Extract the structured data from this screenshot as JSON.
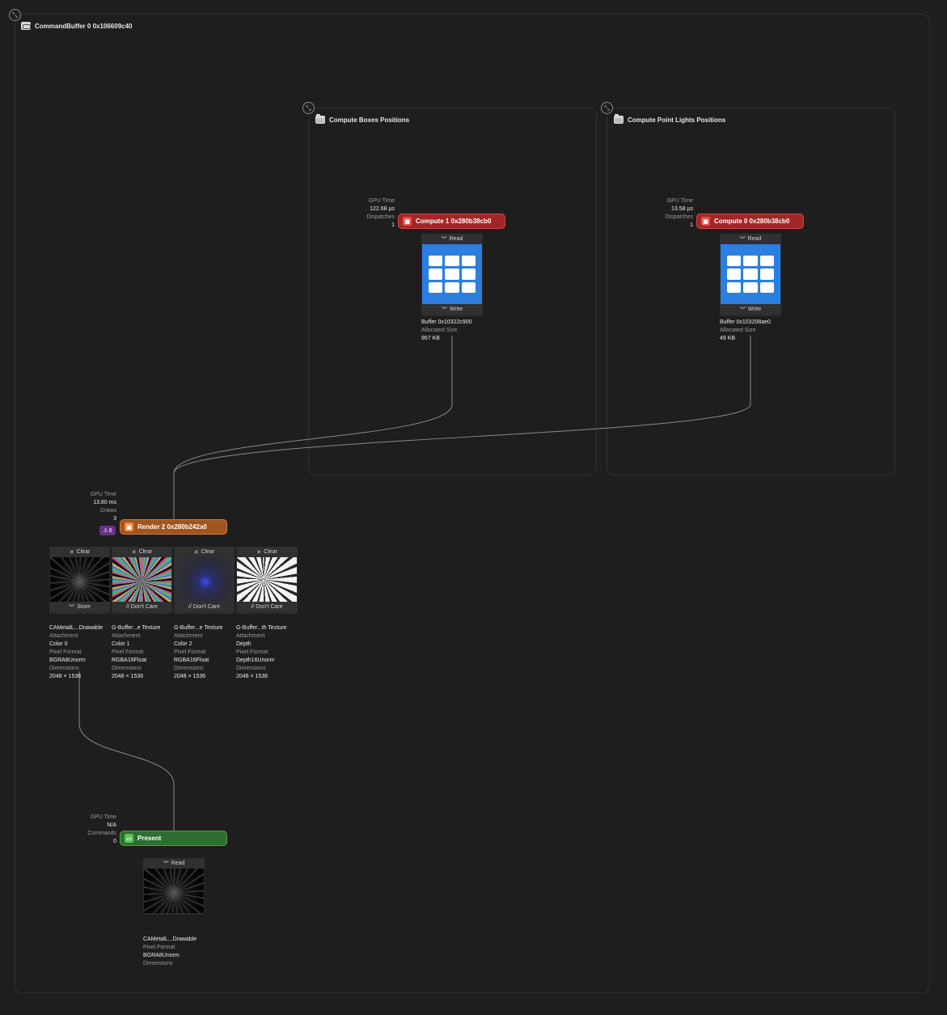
{
  "command_buffer": {
    "title": "CommandBuffer 0 0x106609c40"
  },
  "groups": [
    {
      "title": "Compute Boxes Positions"
    },
    {
      "title": "Compute Point Lights Positions"
    }
  ],
  "compute1": {
    "gpu_time_label": "GPU Time",
    "gpu_time": "122.68 µs",
    "dispatches_label": "Dispatches",
    "dispatches": "1",
    "label": "Compute 1 0x280b38cb0",
    "buffer": {
      "read": "Read",
      "write": "Write",
      "name": "Buffer 0x10322c900",
      "size_label": "Allocated Size",
      "size": "967 KB"
    }
  },
  "compute0": {
    "gpu_time_label": "GPU Time",
    "gpu_time": "13.58 µs",
    "dispatches_label": "Dispatches",
    "dispatches": "1",
    "label": "Compute 0 0x280b38cb0",
    "buffer": {
      "read": "Read",
      "write": "Write",
      "name": "Buffer 0x103208ae0",
      "size_label": "Allocated Size",
      "size": "49 KB"
    }
  },
  "render2": {
    "gpu_time_label": "GPU Time",
    "gpu_time": "13.80 ms",
    "draws_label": "Draws",
    "draws": "3",
    "warnings": "6",
    "label": "Render 2 0x280b242a0",
    "attachments": [
      {
        "load": "Clear",
        "store": "Store",
        "name": "CAMetalL...Drawable",
        "attachment": "Color 0",
        "format": "BGRA8Unorm",
        "dimensions": "2048 × 1536"
      },
      {
        "load": "Clear",
        "store": "// Don't Care",
        "name": "G-Buffer...e Texture",
        "attachment": "Color 1",
        "format": "RGBA16Float",
        "dimensions": "2048 × 1536"
      },
      {
        "load": "Clear",
        "store": "// Don't Care",
        "name": "G-Buffer...e Texture",
        "attachment": "Color 2",
        "format": "RGBA16Float",
        "dimensions": "2048 × 1536"
      },
      {
        "load": "Clear",
        "store": "// Don't Care",
        "name": "G-Buffer...th Texture",
        "attachment": "Depth",
        "format": "Depth16Unorm",
        "dimensions": "2048 × 1536"
      }
    ]
  },
  "labels": {
    "attachment": "Attachment",
    "pixel_format": "Pixel Format",
    "dimensions": "Dimensions"
  },
  "present": {
    "gpu_time_label": "GPU Time",
    "gpu_time": "N/A",
    "commands_label": "Commands",
    "commands": "0",
    "label": "Present",
    "texture": {
      "read": "Read",
      "name": "CAMetalL...Drawable",
      "format_label": "Pixel Format",
      "format": "BGRA8Unorm",
      "dimensions_label": "Dimensions"
    }
  },
  "colors": {
    "background": "#1e1e1e",
    "compute": "#a02726",
    "render": "#a1551e",
    "present": "#2f6e30",
    "buffer": "#2a7fe0",
    "warning": "#6b2e8c"
  },
  "icons": {
    "collapse": "collapse-arrows-icon",
    "folder": "folder-icon",
    "command_buffer": "command-buffer-icon",
    "compute": "compute-calculator-icon",
    "render": "render-image-icon",
    "present": "present-display-icon",
    "buffer": "buffer-grid-icon",
    "read": "chevrons-down-icon",
    "write": "chevrons-down-icon",
    "clear": "x-clear-icon",
    "warning": "warning-triangle-icon"
  }
}
